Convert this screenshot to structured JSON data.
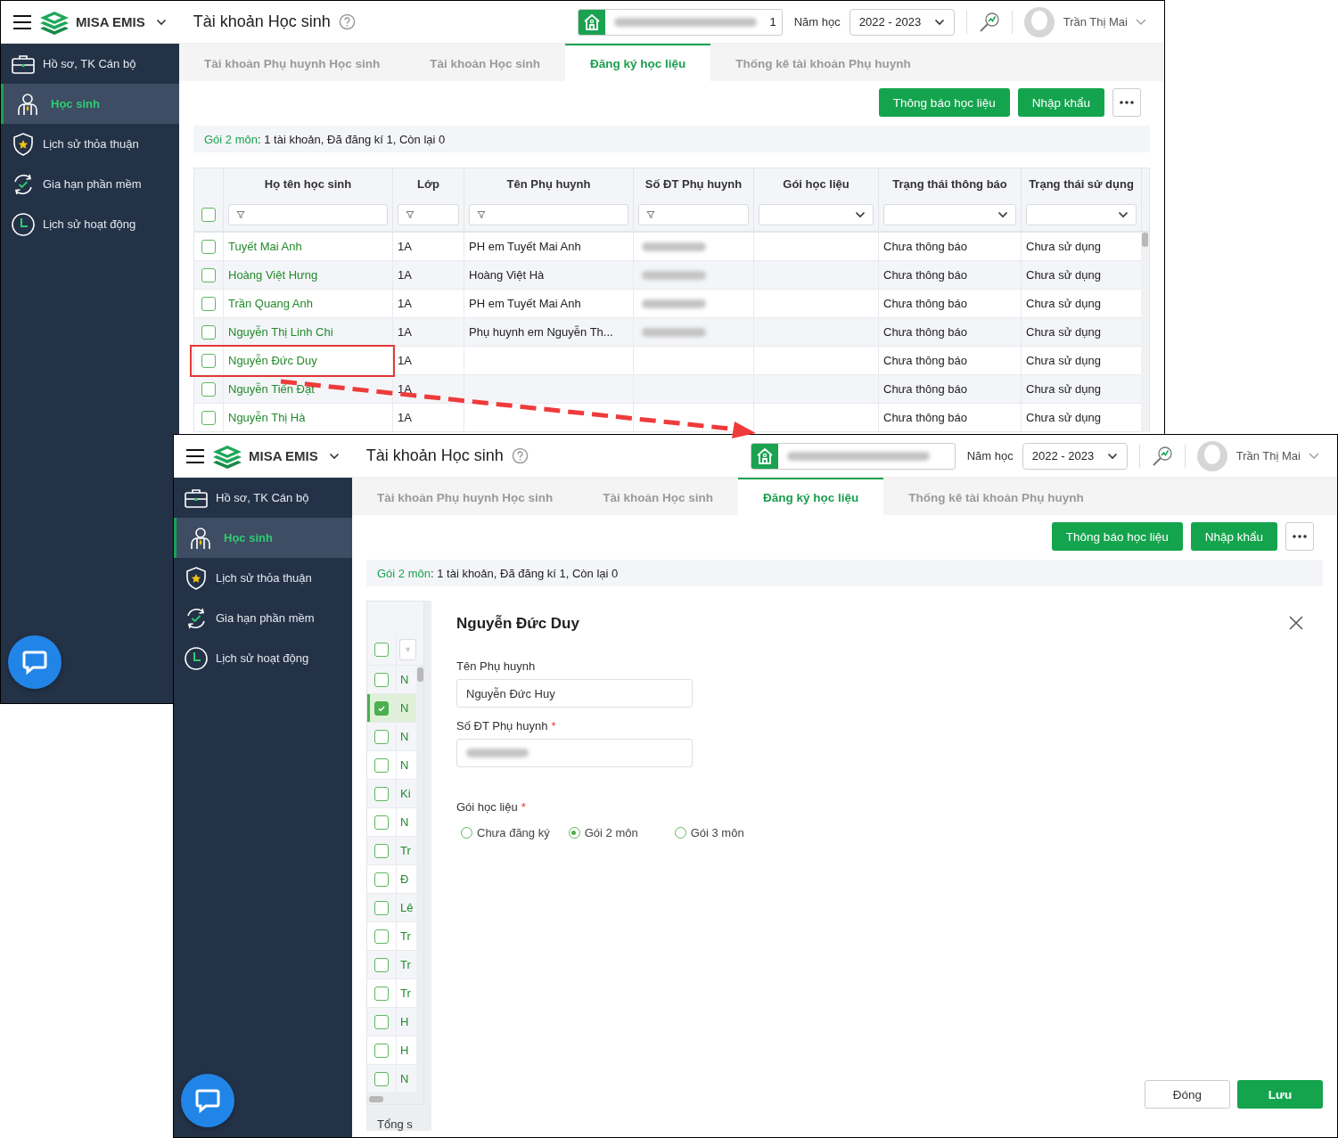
{
  "windows": [
    {
      "header": {
        "brand": "MISA EMIS",
        "title": "Tài khoản Học sinh",
        "school_suffix": "1",
        "year_label": "Năm học",
        "year": "2022 - 2023",
        "user": "Trần Thị Mai"
      },
      "sidebar": [
        {
          "label": "Hồ sơ, TK Cán bộ",
          "selected": false
        },
        {
          "label": "Học sinh",
          "selected": true
        },
        {
          "label": "Lịch sử thỏa thuận",
          "selected": false
        },
        {
          "label": "Gia hạn phần mềm",
          "selected": false
        },
        {
          "label": "Lịch sử hoạt động",
          "selected": false
        }
      ],
      "tabs": [
        {
          "label": "Tài khoản Phụ huynh Học sinh",
          "selected": false
        },
        {
          "label": "Tài khoản Học sinh",
          "selected": false
        },
        {
          "label": "Đăng ký học liệu",
          "selected": true
        },
        {
          "label": "Thống kê tài khoản Phụ huynh",
          "selected": false
        }
      ],
      "actions": [
        "Thông báo học liệu",
        "Nhập khẩu"
      ],
      "summary": {
        "package": "Gói 2 môn",
        "text": ": 1 tài khoản, Đã đăng kí 1, Còn lại 0"
      },
      "table": {
        "all_checked": false,
        "columns": [
          {
            "label": "Họ tên học sinh",
            "kind": "text"
          },
          {
            "label": "Lớp",
            "kind": "text"
          },
          {
            "label": "Tên Phụ huynh",
            "kind": "text"
          },
          {
            "label": "Số ĐT Phụ huynh",
            "kind": "text"
          },
          {
            "label": "Gói học liệu",
            "kind": "select"
          },
          {
            "label": "Trạng thái thông báo",
            "kind": "select"
          },
          {
            "label": "Trạng thái sử dụng",
            "kind": "select"
          }
        ],
        "rows": [
          {
            "name": "Tuyết Mai Anh",
            "class": "1A",
            "parent": "PH em Tuyết Mai Anh",
            "phone_blurred": true,
            "notify_status": "Chưa thông báo",
            "usage_status": "Chưa sử dụng",
            "checked": false,
            "highlighted": false
          },
          {
            "name": "Hoàng Việt Hưng",
            "class": "1A",
            "parent": "Hoàng Việt Hà",
            "phone_blurred": true,
            "notify_status": "Chưa thông báo",
            "usage_status": "Chưa sử dụng",
            "checked": false,
            "highlighted": false
          },
          {
            "name": "Trần Quang Anh",
            "class": "1A",
            "parent": "PH em Tuyết Mai Anh",
            "phone_blurred": true,
            "notify_status": "Chưa thông báo",
            "usage_status": "Chưa sử dụng",
            "checked": false,
            "highlighted": false
          },
          {
            "name": "Nguyễn Thị Linh Chi",
            "class": "1A",
            "parent": "Phụ huynh em Nguyễn Th...",
            "phone_blurred": true,
            "notify_status": "Chưa thông báo",
            "usage_status": "Chưa sử dụng",
            "checked": false,
            "highlighted": false
          },
          {
            "name": "Nguyễn Đức Duy",
            "class": "1A",
            "phone_blurred": false,
            "notify_status": "Chưa thông báo",
            "usage_status": "Chưa sử dụng",
            "checked": false,
            "highlighted": true
          },
          {
            "name": "Nguyễn Tiến Đạt",
            "class": "1A",
            "phone_blurred": false,
            "notify_status": "Chưa thông báo",
            "usage_status": "Chưa sử dụng",
            "checked": false,
            "highlighted": false
          },
          {
            "name": "Nguyễn Thị Hà",
            "class": "1A",
            "phone_blurred": false,
            "notify_status": "Chưa thông báo",
            "usage_status": "Chưa sử dụng",
            "checked": false,
            "highlighted": false
          }
        ]
      }
    },
    {
      "header": {
        "brand": "MISA EMIS",
        "title": "Tài khoản Học sinh",
        "year_label": "Năm học",
        "year": "2022 - 2023",
        "user": "Trần Thị Mai"
      },
      "sidebar": [
        {
          "label": "Hồ sơ, TK Cán bộ",
          "selected": false
        },
        {
          "label": "Học sinh",
          "selected": true
        },
        {
          "label": "Lịch sử thỏa thuận",
          "selected": false
        },
        {
          "label": "Gia hạn phần mềm",
          "selected": false
        },
        {
          "label": "Lịch sử hoạt động",
          "selected": false
        }
      ],
      "tabs": [
        {
          "label": "Tài khoản Phụ huynh Học sinh",
          "selected": false
        },
        {
          "label": "Tài khoản Học sinh",
          "selected": false
        },
        {
          "label": "Đăng ký học liệu",
          "selected": true
        },
        {
          "label": "Thống kê tài khoản Phụ huynh",
          "selected": false
        }
      ],
      "actions": [
        "Thông báo học liệu",
        "Nhập khẩu"
      ],
      "summary": {
        "package": "Gói 2 môn",
        "text": ": 1 tài khoản, Đã đăng kí 1, Còn lại 0"
      },
      "list": {
        "all_checked": false,
        "rows": [
          {
            "name": "N",
            "checked": false,
            "selected": false
          },
          {
            "name": "N",
            "checked": true,
            "selected": true
          },
          {
            "name": "N",
            "checked": false,
            "selected": false
          },
          {
            "name": "N",
            "checked": false,
            "selected": false
          },
          {
            "name": "Ki",
            "checked": false,
            "selected": false
          },
          {
            "name": "N",
            "checked": false,
            "selected": false
          },
          {
            "name": "Tr",
            "checked": false,
            "selected": false
          },
          {
            "name": "Đ",
            "checked": false,
            "selected": false
          },
          {
            "name": "Lê",
            "checked": false,
            "selected": false
          },
          {
            "name": "Tr",
            "checked": false,
            "selected": false
          },
          {
            "name": "Tr",
            "checked": false,
            "selected": false
          },
          {
            "name": "Tr",
            "checked": false,
            "selected": false
          },
          {
            "name": "H",
            "checked": false,
            "selected": false
          },
          {
            "name": "H",
            "checked": false,
            "selected": false
          },
          {
            "name": "N",
            "checked": false,
            "selected": false
          }
        ],
        "footer": "Tổng s"
      },
      "dialog": {
        "title": "Nguyễn Đức Duy",
        "fields": [
          {
            "label": "Tên Phụ huynh",
            "value": "Nguyễn Đức Huy",
            "blurred": false
          },
          {
            "label": "Số ĐT Phụ huynh",
            "required_mark": "*",
            "blurred": true
          }
        ],
        "package_label": "Gói học liệu",
        "package_required_mark": "*",
        "options": [
          {
            "label": "Chưa đăng ký",
            "selected": false
          },
          {
            "label": "Gói 2 môn",
            "selected": true
          },
          {
            "label": "Gói 3 môn",
            "selected": false
          }
        ],
        "buttons": [
          {
            "label": "Đóng",
            "kind": "secondary"
          },
          {
            "label": "Lưu",
            "kind": "primary"
          }
        ]
      }
    }
  ]
}
